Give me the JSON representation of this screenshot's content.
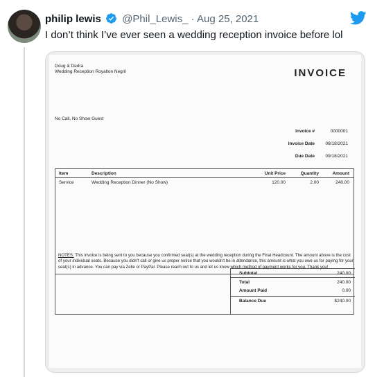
{
  "tweet": {
    "author_name": "philip lewis",
    "handle": "@Phil_Lewis_",
    "separator": "·",
    "date": "Aug 25, 2021",
    "text": "I don’t think I’ve ever seen a wedding reception invoice before lol"
  },
  "invoice": {
    "from_line1": "Doug & Dedra",
    "from_line2": "Wedding Reception Royalton Negril",
    "title": "INVOICE",
    "bill_to": "No Call, No Show Guest",
    "meta": [
      {
        "label": "Invoice #",
        "value": "0000001"
      },
      {
        "label": "Invoice Date",
        "value": "08/18/2021"
      },
      {
        "label": "Due Date",
        "value": "09/18/2021"
      }
    ],
    "columns": {
      "item": "Item",
      "description": "Description",
      "unit_price": "Unit Price",
      "quantity": "Quantity",
      "amount": "Amount"
    },
    "rows": [
      {
        "item": "Service",
        "description": "Wedding Reception Dinner (No Show)",
        "unit_price": "120.00",
        "quantity": "2.00",
        "amount": "240.00"
      }
    ],
    "notes_label": "NOTES:",
    "notes_text": " This invoice is being sent to you because you confirmed seat(s) at the wedding reception during the Final Headcount. The amount above is the cost of your individual seats. Because you didn't call or give us proper notice that you wouldn't be in attendance, this amount is what you owe us for paying for your seat(s) in advance. You can pay via Zelle or PayPal. Please reach out to us and let us know which method of payment works for you. Thank you!",
    "totals": {
      "subtotal_label": "Subtotal",
      "subtotal": "240.00",
      "total_label": "Total",
      "total": "240.00",
      "paid_label": "Amount Paid",
      "paid": "0.00",
      "balance_label": "Balance Due",
      "balance": "$240.00"
    }
  },
  "colors": {
    "twitter_blue": "#1d9bf0",
    "text_secondary": "#536471"
  },
  "icons": {
    "verified": "verified-badge-icon",
    "logo": "twitter-bird-icon"
  }
}
